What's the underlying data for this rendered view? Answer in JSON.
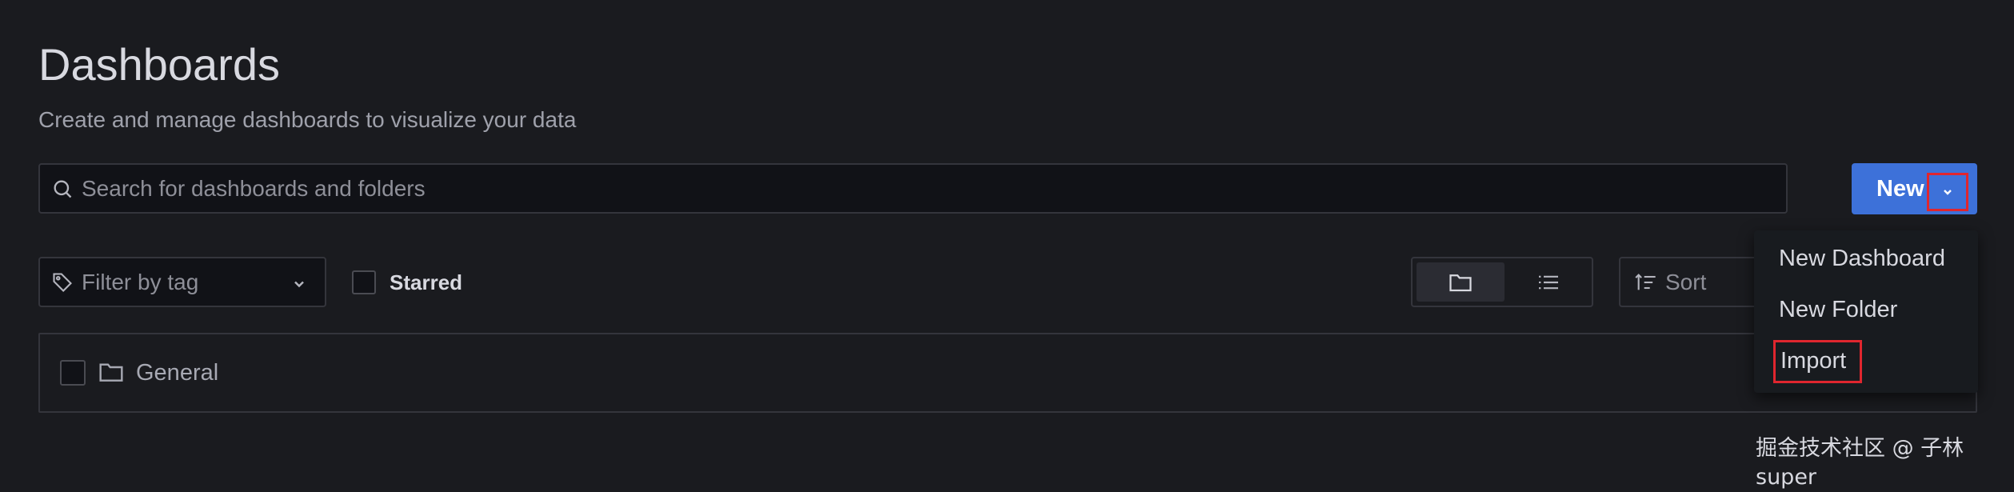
{
  "page": {
    "title": "Dashboards",
    "subtitle": "Create and manage dashboards to visualize your data"
  },
  "search": {
    "placeholder": "Search for dashboards and folders",
    "icon": "search-icon"
  },
  "new_button": {
    "label": "New",
    "icon": "chevron-down-icon",
    "color": "#3d71d9"
  },
  "filters": {
    "tag_placeholder": "Filter by tag",
    "starred_label": "Starred",
    "starred_checked": false,
    "view_mode": "folders",
    "sort_placeholder": "Sort"
  },
  "folders": [
    {
      "label": "General",
      "icon": "folder-icon",
      "checked": false
    }
  ],
  "new_menu": {
    "items": [
      {
        "label": "New Dashboard"
      },
      {
        "label": "New Folder"
      },
      {
        "label": "Import",
        "highlighted": true
      }
    ]
  },
  "highlight_color": "#e0262e",
  "watermark": "掘金技术社区 @ 子林super"
}
